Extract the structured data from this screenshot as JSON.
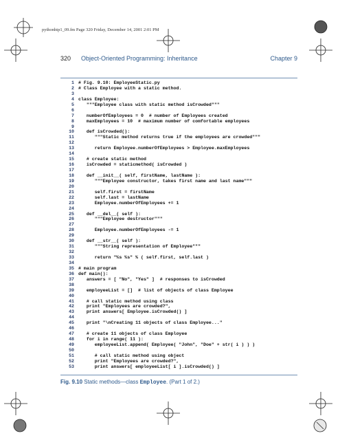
{
  "printer_line": "pythonhtp1_09.fm Page 320 Friday, December 14, 2001 2:01 PM",
  "header": {
    "page_number": "320",
    "title": "Object-Oriented Programming: Inheritance",
    "chapter": "Chapter 9"
  },
  "code_lines": [
    {
      "n": "1",
      "t": "# Fig. 9.10: EmployeeStatic.py"
    },
    {
      "n": "2",
      "t": "# Class Employee with a static method."
    },
    {
      "n": "3",
      "t": ""
    },
    {
      "n": "4",
      "t": "class Employee:"
    },
    {
      "n": "5",
      "t": "   \"\"\"Employee class with static method isCrowded\"\"\""
    },
    {
      "n": "6",
      "t": ""
    },
    {
      "n": "7",
      "t": "   numberOfEmployees = 0  # number of Employees created"
    },
    {
      "n": "8",
      "t": "   maxEmployees = 10  # maximum number of comfortable employees"
    },
    {
      "n": "9",
      "t": ""
    },
    {
      "n": "10",
      "t": "   def isCrowded():"
    },
    {
      "n": "11",
      "t": "      \"\"\"Static method returns true if the employees are crowded\"\"\""
    },
    {
      "n": "12",
      "t": ""
    },
    {
      "n": "13",
      "t": "      return Employee.numberOfEmployees > Employee.maxEmployees"
    },
    {
      "n": "14",
      "t": ""
    },
    {
      "n": "15",
      "t": "   # create static method"
    },
    {
      "n": "16",
      "t": "   isCrowded = staticmethod( isCrowded )"
    },
    {
      "n": "17",
      "t": ""
    },
    {
      "n": "18",
      "t": "   def __init__( self, firstName, lastName ):"
    },
    {
      "n": "19",
      "t": "      \"\"\"Employee constructor, takes first name and last name\"\"\""
    },
    {
      "n": "20",
      "t": ""
    },
    {
      "n": "21",
      "t": "      self.first = firstName"
    },
    {
      "n": "22",
      "t": "      self.last = lastName"
    },
    {
      "n": "23",
      "t": "      Employee.numberOfEmployees += 1"
    },
    {
      "n": "24",
      "t": ""
    },
    {
      "n": "25",
      "t": "   def __del__( self ):"
    },
    {
      "n": "26",
      "t": "      \"\"\"Employee destructor\"\"\""
    },
    {
      "n": "27",
      "t": ""
    },
    {
      "n": "28",
      "t": "      Employee.numberOfEmployees -= 1"
    },
    {
      "n": "29",
      "t": ""
    },
    {
      "n": "30",
      "t": "   def __str__( self ):"
    },
    {
      "n": "31",
      "t": "      \"\"\"String representation of Employee\"\"\""
    },
    {
      "n": "32",
      "t": ""
    },
    {
      "n": "33",
      "t": "      return \"%s %s\" % ( self.first, self.last )"
    },
    {
      "n": "34",
      "t": ""
    },
    {
      "n": "35",
      "t": "# main program"
    },
    {
      "n": "36",
      "t": "def main():"
    },
    {
      "n": "37",
      "t": "   answers = [ \"No\", \"Yes\" ]  # responses to isCrowded"
    },
    {
      "n": "38",
      "t": ""
    },
    {
      "n": "39",
      "t": "   employeeList = []  # list of objects of class Employee"
    },
    {
      "n": "40",
      "t": ""
    },
    {
      "n": "41",
      "t": "   # call static method using class"
    },
    {
      "n": "42",
      "t": "   print \"Employees are crowded?\","
    },
    {
      "n": "43",
      "t": "   print answers[ Employee.isCrowded() ]"
    },
    {
      "n": "44",
      "t": ""
    },
    {
      "n": "45",
      "t": "   print \"\\nCreating 11 objects of class Employee...\""
    },
    {
      "n": "46",
      "t": ""
    },
    {
      "n": "47",
      "t": "   # create 11 objects of class Employee"
    },
    {
      "n": "48",
      "t": "   for i in range( 11 ):"
    },
    {
      "n": "49",
      "t": "      employeeList.append( Employee( \"John\", \"Doe\" + str( i ) ) )"
    },
    {
      "n": "50",
      "t": ""
    },
    {
      "n": "51",
      "t": "      # call static method using object"
    },
    {
      "n": "52",
      "t": "      print \"Employees are crowded?\","
    },
    {
      "n": "53",
      "t": "      print answers[ employeeList[ i ].isCrowded() ]"
    }
  ],
  "caption": {
    "fig": "Fig. 9.10",
    "text_before": "Static methods—class",
    "class_name": "Employee",
    "text_after": ". (Part 1 of 2.)"
  }
}
